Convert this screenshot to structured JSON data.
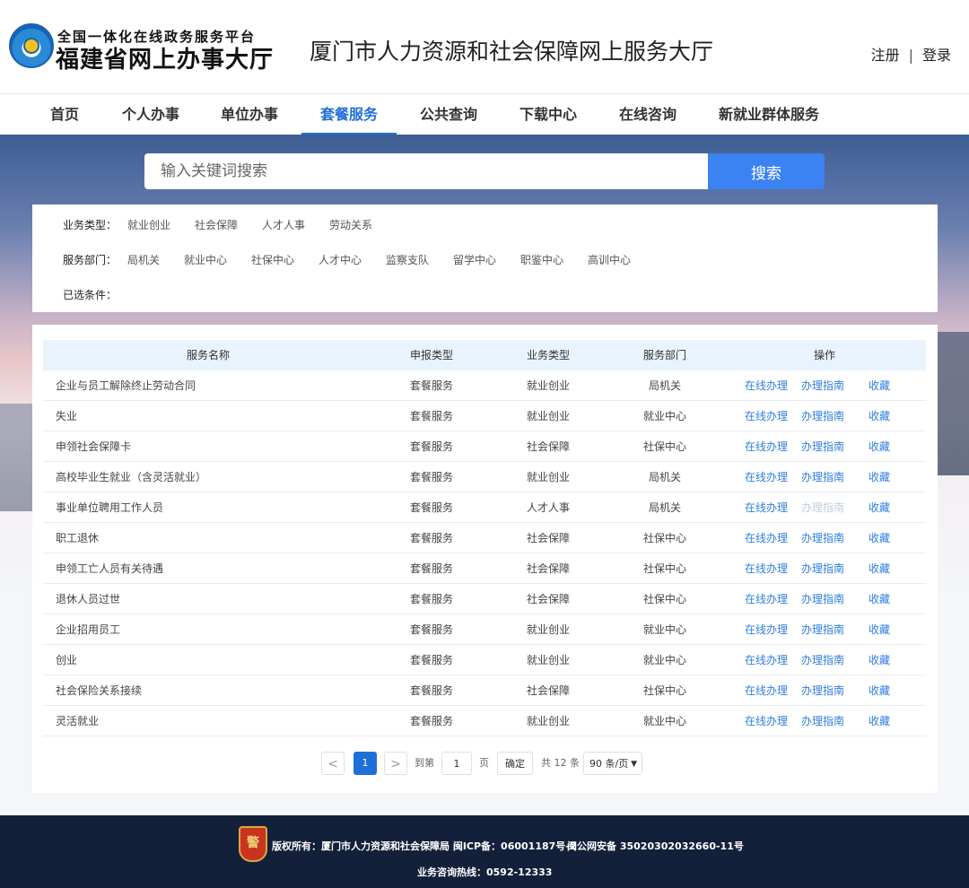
{
  "header": {
    "platform_small": "全国一体化在线政务服务平台",
    "platform_big": "福建省网上办事大厅",
    "site_title": "厦门市人力资源和社会保障网上服务大厅",
    "register": "注册",
    "separator": "|",
    "login": "登录"
  },
  "nav": [
    {
      "label": "首页"
    },
    {
      "label": "个人办事"
    },
    {
      "label": "单位办事"
    },
    {
      "label": "套餐服务",
      "active": true
    },
    {
      "label": "公共查询"
    },
    {
      "label": "下载中心"
    },
    {
      "label": "在线咨询"
    },
    {
      "label": "新就业群体服务"
    }
  ],
  "search": {
    "placeholder": "输入关键词搜索",
    "button": "搜索"
  },
  "filters": {
    "business_type": {
      "label": "业务类型：",
      "options": [
        "就业创业",
        "社会保障",
        "人才人事",
        "劳动关系"
      ]
    },
    "department": {
      "label": "服务部门：",
      "options": [
        "局机关",
        "就业中心",
        "社保中心",
        "人才中心",
        "监察支队",
        "留学中心",
        "职鉴中心",
        "高训中心"
      ]
    },
    "selected": {
      "label": "已选条件："
    }
  },
  "table": {
    "columns": [
      "服务名称",
      "申报类型",
      "业务类型",
      "服务部门",
      "操作"
    ],
    "actions": {
      "online": "在线办理",
      "guide": "办理指南",
      "favorite": "收藏"
    },
    "rows": [
      {
        "name": "企业与员工解除终止劳动合同",
        "apply_type": "套餐服务",
        "biz_type": "就业创业",
        "dept": "局机关",
        "guide_enabled": true
      },
      {
        "name": "失业",
        "apply_type": "套餐服务",
        "biz_type": "就业创业",
        "dept": "就业中心",
        "guide_enabled": true
      },
      {
        "name": "申领社会保障卡",
        "apply_type": "套餐服务",
        "biz_type": "社会保障",
        "dept": "社保中心",
        "guide_enabled": true
      },
      {
        "name": "高校毕业生就业（含灵活就业）",
        "apply_type": "套餐服务",
        "biz_type": "就业创业",
        "dept": "局机关",
        "guide_enabled": true
      },
      {
        "name": "事业单位聘用工作人员",
        "apply_type": "套餐服务",
        "biz_type": "人才人事",
        "dept": "局机关",
        "guide_enabled": false
      },
      {
        "name": "职工退休",
        "apply_type": "套餐服务",
        "biz_type": "社会保障",
        "dept": "社保中心",
        "guide_enabled": true
      },
      {
        "name": "申领工亡人员有关待遇",
        "apply_type": "套餐服务",
        "biz_type": "社会保障",
        "dept": "社保中心",
        "guide_enabled": true
      },
      {
        "name": "退休人员过世",
        "apply_type": "套餐服务",
        "biz_type": "社会保障",
        "dept": "社保中心",
        "guide_enabled": true
      },
      {
        "name": "企业招用员工",
        "apply_type": "套餐服务",
        "biz_type": "就业创业",
        "dept": "就业中心",
        "guide_enabled": true
      },
      {
        "name": "创业",
        "apply_type": "套餐服务",
        "biz_type": "就业创业",
        "dept": "就业中心",
        "guide_enabled": true
      },
      {
        "name": "社会保险关系接续",
        "apply_type": "套餐服务",
        "biz_type": "社会保障",
        "dept": "社保中心",
        "guide_enabled": true
      },
      {
        "name": "灵活就业",
        "apply_type": "套餐服务",
        "biz_type": "就业创业",
        "dept": "就业中心",
        "guide_enabled": true
      }
    ]
  },
  "pagination": {
    "prev": "<",
    "current": "1",
    "next": ">",
    "goto_label": "到第",
    "goto_value": "1",
    "page_unit": "页",
    "confirm": "确定",
    "total": "共 12 条",
    "page_size": "90 条/页"
  },
  "footer": {
    "badge_text": "警",
    "copyright": "版权所有：厦门市人力资源和社会保障局 闽ICP备：06001187号-2",
    "police": "闽公网安备 35020302032660-11号",
    "hotline": "业务咨询热线：0592-12333"
  },
  "colors": {
    "accent": "#1e6fd8",
    "search_button": "#3b82f2",
    "footer_bg": "#13203a",
    "action_link": "#2f7ee0"
  }
}
